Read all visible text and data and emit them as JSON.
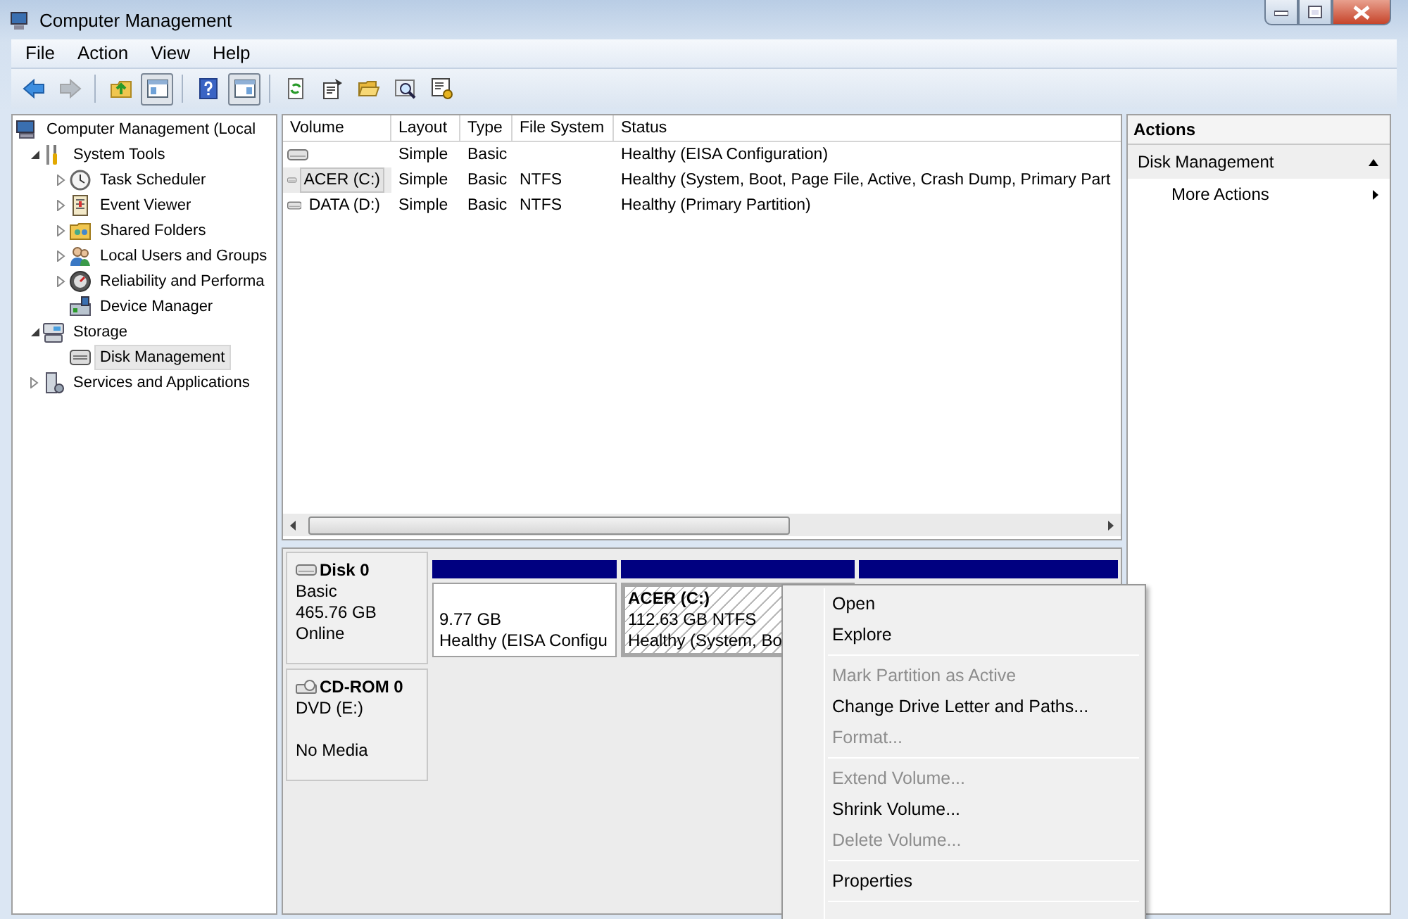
{
  "window": {
    "title": "Computer Management"
  },
  "menu_bar": [
    "File",
    "Action",
    "View",
    "Help"
  ],
  "toolbar": [
    {
      "pressed": false,
      "disabled": false
    },
    {
      "pressed": false,
      "disabled": true
    },
    {
      "pressed": false,
      "disabled": false
    },
    {
      "pressed": true,
      "disabled": false
    },
    {
      "pressed": false,
      "disabled": false
    },
    {
      "pressed": true,
      "disabled": false
    },
    {
      "pressed": false,
      "disabled": false
    },
    {
      "pressed": false,
      "disabled": false
    },
    {
      "pressed": false,
      "disabled": false
    },
    {
      "pressed": false,
      "disabled": false
    },
    {
      "pressed": false,
      "disabled": false
    }
  ],
  "tree": [
    {
      "label": "Computer Management (Local",
      "selected": false,
      "children": [
        {
          "label": "System Tools",
          "selected": false,
          "expanded": true,
          "children": [
            {
              "label": "Task Scheduler",
              "selected": false,
              "expanded": false
            },
            {
              "label": "Event Viewer",
              "selected": false,
              "expanded": false
            },
            {
              "label": "Shared Folders",
              "selected": false,
              "expanded": false
            },
            {
              "label": "Local Users and Groups",
              "selected": false,
              "expanded": false
            },
            {
              "label": "Reliability and Performa",
              "selected": false,
              "expanded": false
            },
            {
              "label": "Device Manager",
              "selected": false
            }
          ]
        },
        {
          "label": "Storage",
          "selected": false,
          "expanded": true,
          "children": [
            {
              "label": "Disk Management",
              "selected": true
            }
          ]
        },
        {
          "label": "Services and Applications",
          "selected": false,
          "expanded": false
        }
      ]
    }
  ],
  "volume_table": {
    "columns": [
      "Volume",
      "Layout",
      "Type",
      "File System",
      "Status"
    ],
    "rows": [
      {
        "layout": "Simple",
        "type": "Basic",
        "status": "Healthy (EISA Configuration)",
        "selected": false
      },
      {
        "volume": "ACER (C:)",
        "layout": "Simple",
        "type": "Basic",
        "file_system": "NTFS",
        "status": "Healthy (System, Boot, Page File, Active, Crash Dump, Primary Part",
        "selected": true
      },
      {
        "volume": "DATA (D:)",
        "layout": "Simple",
        "type": "Basic",
        "file_system": "NTFS",
        "status": "Healthy (Primary Partition)",
        "selected": false
      }
    ]
  },
  "disks": [
    {
      "name": "Disk 0",
      "type": "Basic",
      "size": "465.76 GB",
      "status": "Online",
      "partitions": [
        {
          "kind": "volume",
          "size": "9.77 GB",
          "status": "Healthy (EISA Configu",
          "selected": false
        },
        {
          "kind": "volume",
          "title": "ACER  (C:)",
          "size": "112.63 GB NTFS",
          "status": "Healthy (System, Bo",
          "selected": true
        },
        {
          "kind": "bar"
        }
      ]
    },
    {
      "name": "CD-ROM 0",
      "type": "DVD (E:)",
      "status": "No Media"
    }
  ],
  "actions": {
    "title": "Actions",
    "sections": [
      {
        "label": "Disk Management",
        "expanded": true,
        "items": [
          {
            "label": "More Actions"
          }
        ]
      }
    ]
  },
  "context_menu": {
    "groups": [
      [
        {
          "label": "Open",
          "disabled": false
        },
        {
          "label": "Explore",
          "disabled": false
        }
      ],
      [
        {
          "label": "Mark Partition as Active",
          "disabled": true
        },
        {
          "label": "Change Drive Letter and Paths...",
          "disabled": false
        },
        {
          "label": "Format...",
          "disabled": true
        }
      ],
      [
        {
          "label": "Extend Volume...",
          "disabled": true
        },
        {
          "label": "Shrink Volume...",
          "disabled": false
        },
        {
          "label": "Delete Volume...",
          "disabled": true
        }
      ],
      [
        {
          "label": "Properties",
          "disabled": false
        }
      ]
    ]
  }
}
